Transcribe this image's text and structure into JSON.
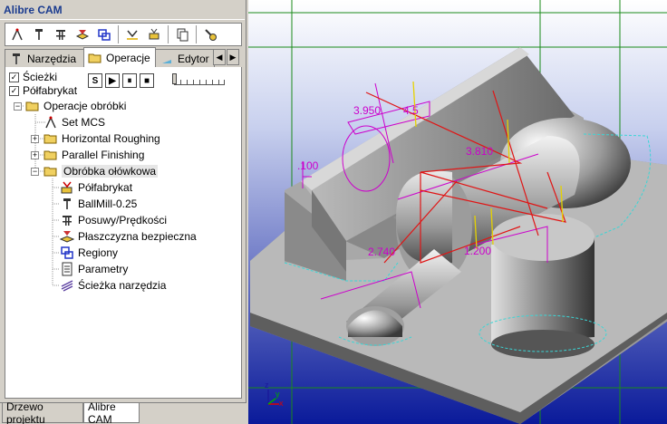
{
  "panel": {
    "title": "Alibre CAM"
  },
  "toolbar": {
    "icons": [
      "compass-tool-icon",
      "tool-icon",
      "feeds-icon",
      "safe-plane-icon",
      "regions-icon",
      "toolpath-icon",
      "stock-icon",
      "copy-icon",
      "settings-icon"
    ]
  },
  "tabs": [
    {
      "label": "Narzędzia"
    },
    {
      "label": "Operacje"
    },
    {
      "label": "Edytor"
    }
  ],
  "ops": {
    "paths_label": "Ścieżki",
    "paths_checked": true,
    "stock_label": "Półfabrykat",
    "stock_checked": true,
    "buttons": [
      "S",
      "▶",
      "⏸",
      "■"
    ]
  },
  "tree": {
    "root": "Operacje obróbki",
    "set_mcs": "Set MCS",
    "horizontal": "Horizontal Roughing",
    "parallel": "Parallel Finishing",
    "pencil": "Obróbka ołówkowa",
    "children": [
      "Półfabrykat",
      "BallMill-0.25",
      "Posuwy/Prędkości",
      "Płaszczyzna bezpieczna",
      "Regiony",
      "Parametry",
      "Ścieżka narzędzia"
    ]
  },
  "bottom_tabs": [
    "Drzewo projektu",
    "Alibre CAM"
  ],
  "viewport": {
    "dims": [
      "3.950",
      "4.5",
      "3.810",
      ".100",
      "2.740",
      "1.200"
    ],
    "axes": [
      "x",
      "y",
      "z"
    ]
  }
}
